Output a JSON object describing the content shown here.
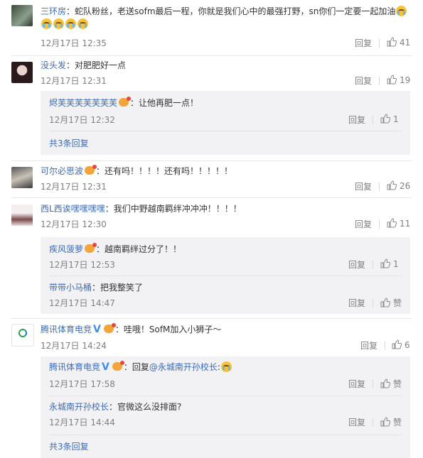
{
  "reply_label": "回复",
  "like_label": "赞",
  "c1": {
    "user": "三环房",
    "text": "：蛇队粉丝，老送sofm最后一程，你就是我们心中的最强打野，sn你们一定要一起加油",
    "time": "12月17日 12:35",
    "likes": "41"
  },
  "c2": {
    "user": "没头发",
    "text": "：对肥肥好一点",
    "time": "12月17日 12:31",
    "likes": "19"
  },
  "c2r1": {
    "user": "烬芙芙芙芙芙芙芙",
    "text": "：让他再肥一点！",
    "time": "12月17日 12:32",
    "likes": "1"
  },
  "c2more": "共3条回复",
  "c3": {
    "user": "可尔必思波",
    "text": "：还有吗！！！！还有吗！！！！！",
    "time": "12月17日 12:31",
    "likes": "26"
  },
  "c4": {
    "user": "西L西诶嘿嘿嘿嘿",
    "text": "：我们中野越南羁绊冲冲冲！！！！",
    "time": "12月17日 12:30",
    "likes": "11"
  },
  "c4r1": {
    "user": "疾风菠萝",
    "text": "：越南羁绊过分了！！",
    "time": "12月17日 12:53",
    "likes": "1"
  },
  "c4r2": {
    "user": "带带小马桶",
    "text": "：把我整笑了",
    "time": "12月17日 14:47"
  },
  "c5": {
    "user": "腾讯体育电竞",
    "text": "：哇哦！SofM加入小狮子～",
    "time": "12月17日 14:24",
    "likes": "6"
  },
  "c5r1": {
    "user": "腾讯体育电竞",
    "text_prefix": "：回复",
    "mention": "@永城南开孙校长",
    "text_suffix": ":",
    "time": "12月17日 17:58"
  },
  "c5r2": {
    "user": "永城南开孙校长",
    "text": "：官微这么没排面?",
    "time": "12月17日 14:44"
  },
  "c5more": "共3条回复",
  "colors": {
    "accent_name": "#eb7350",
    "link": "#3d6bb7",
    "reply_bg": "#f2f2f5"
  }
}
